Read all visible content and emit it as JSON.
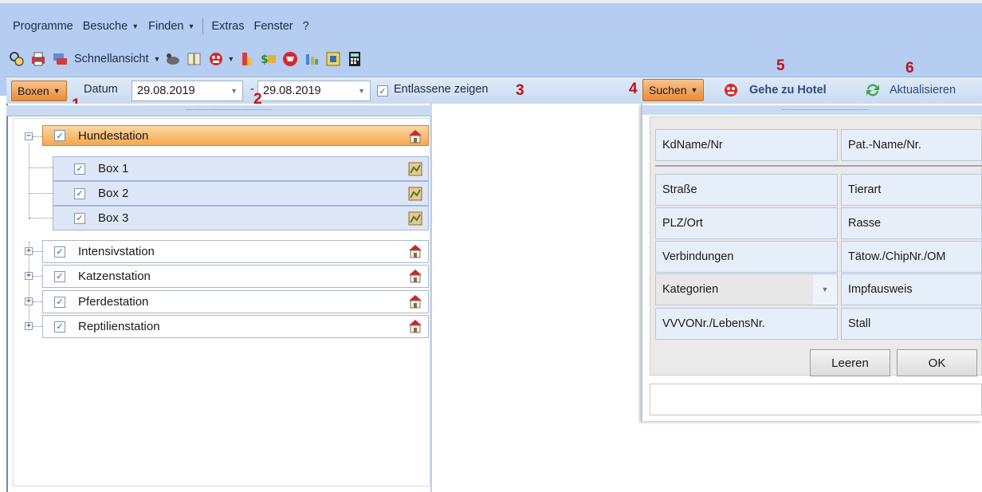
{
  "menubar": {
    "items": [
      {
        "label": "Programme",
        "caret": false
      },
      {
        "label": "Besuche",
        "caret": true
      },
      {
        "label": "Finden",
        "caret": true
      },
      {
        "label": "Extras",
        "caret": false
      },
      {
        "label": "Fenster",
        "caret": false
      },
      {
        "label": "?",
        "caret": false
      }
    ]
  },
  "toolbar": {
    "quickview_label": "Schnellansicht",
    "icons": [
      "user-search-icon",
      "print-icon",
      "transfer-icon",
      "animal-icon",
      "book-icon",
      "hotel-icon",
      "stack-icon",
      "money-icon",
      "shopping-icon",
      "lab-icon",
      "scanner-icon",
      "calculator-icon"
    ]
  },
  "filterbar": {
    "boxes_button": "Boxen",
    "date_label": "Datum",
    "date_from": "29.08.2019",
    "date_sep": "-",
    "date_to": "29.08.2019",
    "show_discharged_label": "Entlassene zeigen",
    "show_discharged_checked": true
  },
  "markers": {
    "m1": "1",
    "m2": "2",
    "m3": "3",
    "m4": "4",
    "m5": "5",
    "m6": "6"
  },
  "tree": {
    "stations": [
      {
        "name": "Hundestation",
        "checked": true,
        "expanded": true,
        "selected": true,
        "boxes": [
          {
            "name": "Box 1",
            "checked": true
          },
          {
            "name": "Box 2",
            "checked": true
          },
          {
            "name": "Box 3",
            "checked": true
          }
        ]
      },
      {
        "name": "Intensivstation",
        "checked": true,
        "expanded": false
      },
      {
        "name": "Katzenstation",
        "checked": true,
        "expanded": false
      },
      {
        "name": "Pferdestation",
        "checked": true,
        "expanded": false
      },
      {
        "name": "Reptilienstation",
        "checked": true,
        "expanded": false
      }
    ]
  },
  "search": {
    "search_button": "Suchen",
    "goto_hotel": "Gehe zu Hotel",
    "refresh": "Aktualisieren",
    "fields": {
      "customer": "KdName/Nr",
      "patient": "Pat.-Name/Nr.",
      "street": "Straße",
      "species": "Tierart",
      "zip_city": "PLZ/Ort",
      "breed": "Rasse",
      "connections": "Verbindungen",
      "chip": "Tätow./ChipNr./OM",
      "categories": "Kategorien",
      "vaccination": "Impfausweis",
      "vvvo": "VVVONr./LebensNr.",
      "stable": "Stall"
    },
    "clear_button": "Leeren",
    "ok_button": "OK"
  },
  "colors": {
    "topbar": "#b4cdf0",
    "accent_orange": "#e88a3a",
    "marker_red": "#c0101a",
    "house_red": "#c8282a"
  }
}
